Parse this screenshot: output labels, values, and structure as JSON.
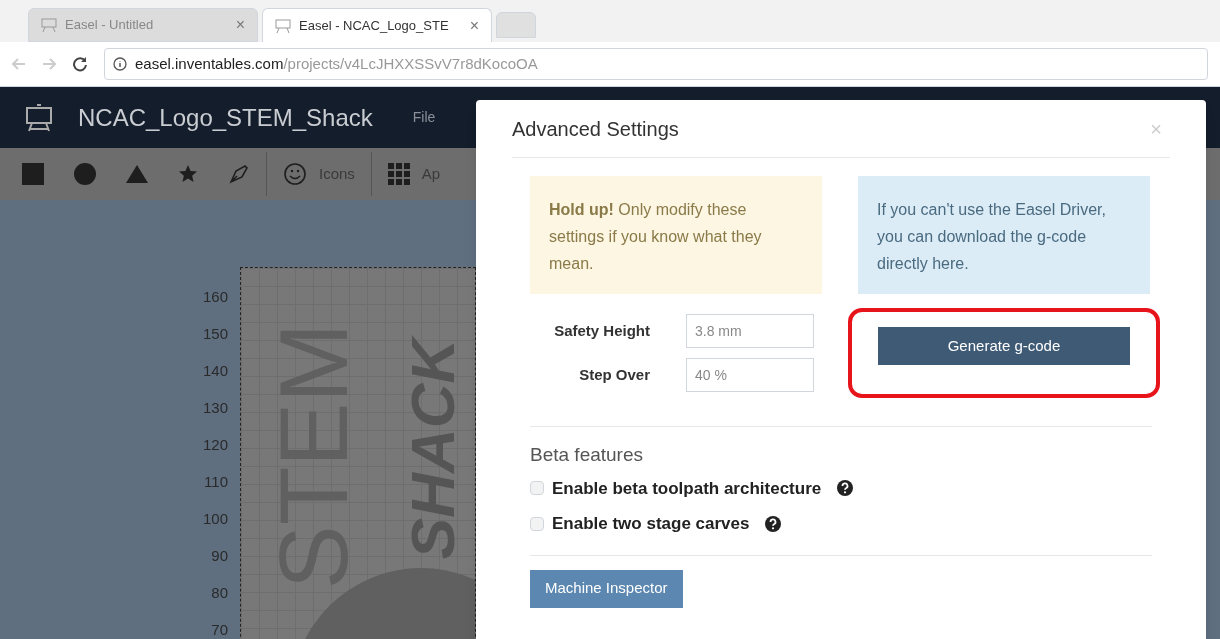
{
  "browser": {
    "tabs": [
      {
        "title": "Easel - Untitled",
        "close": "×",
        "selected": false
      },
      {
        "title": "Easel - NCAC_Logo_STE",
        "close": "×",
        "selected": true
      }
    ],
    "url_host": "easel.inventables.com",
    "url_path": "/projects/v4LcJHXXSSvV7r8dKocoOA"
  },
  "app": {
    "project_title": "NCAC_Logo_STEM_Shack",
    "menu": [
      "File"
    ],
    "toolbar": {
      "icons_label": "Icons",
      "apps_label": "Ap"
    },
    "ruler_labels": [
      "160",
      "150",
      "140",
      "130",
      "120",
      "110",
      "100",
      "90",
      "80",
      "70"
    ],
    "design_texts": [
      "STEM",
      "SHACK"
    ]
  },
  "modal": {
    "title": "Advanced Settings",
    "close": "×",
    "warning": "**Hold up!** Only modify these settings if you know what they mean.",
    "info": "If you can't use the Easel Driver, you can download the g-code directly here.",
    "fields": [
      {
        "label": "Safety Height",
        "value": "3.8 mm"
      },
      {
        "label": "Step Over",
        "value": "40 %"
      }
    ],
    "generate_button": "Generate g-code",
    "highlighted": true,
    "beta_heading": "Beta features",
    "beta_options": [
      {
        "label": "Enable beta toolpath architecture",
        "checked": false
      },
      {
        "label": "Enable two stage carves",
        "checked": false
      }
    ],
    "inspector_button": "Machine Inspector"
  }
}
